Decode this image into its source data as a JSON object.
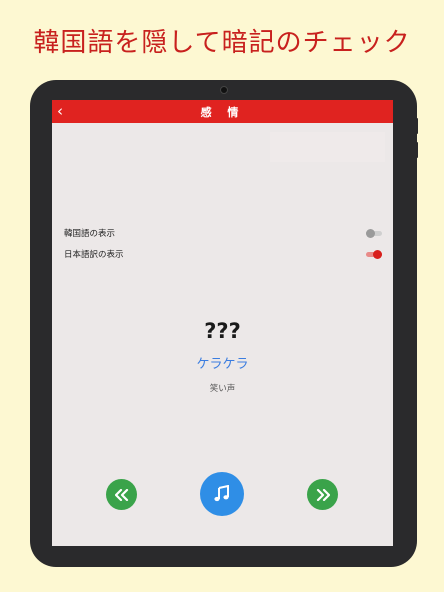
{
  "promo": {
    "title": "韓国語を隠して暗記のチェック"
  },
  "app": {
    "back_icon": "chevron-left-icon",
    "title": "感 情"
  },
  "settings": {
    "items": [
      {
        "label": "韓国語の表示",
        "enabled": false
      },
      {
        "label": "日本語訳の表示",
        "enabled": true
      }
    ]
  },
  "card": {
    "hidden_korean": "???",
    "reading": "ケラケラ",
    "meaning": "笑い声"
  },
  "controls": {
    "prev_icon": "double-chevron-left-icon",
    "play_icon": "music-note-icon",
    "next_icon": "double-chevron-right-icon"
  },
  "colors": {
    "accent_red": "#e02320",
    "reading_blue": "#3b7de0",
    "nav_green": "#3aa34a",
    "play_blue": "#2f8ee6",
    "background": "#fdf8d2"
  }
}
